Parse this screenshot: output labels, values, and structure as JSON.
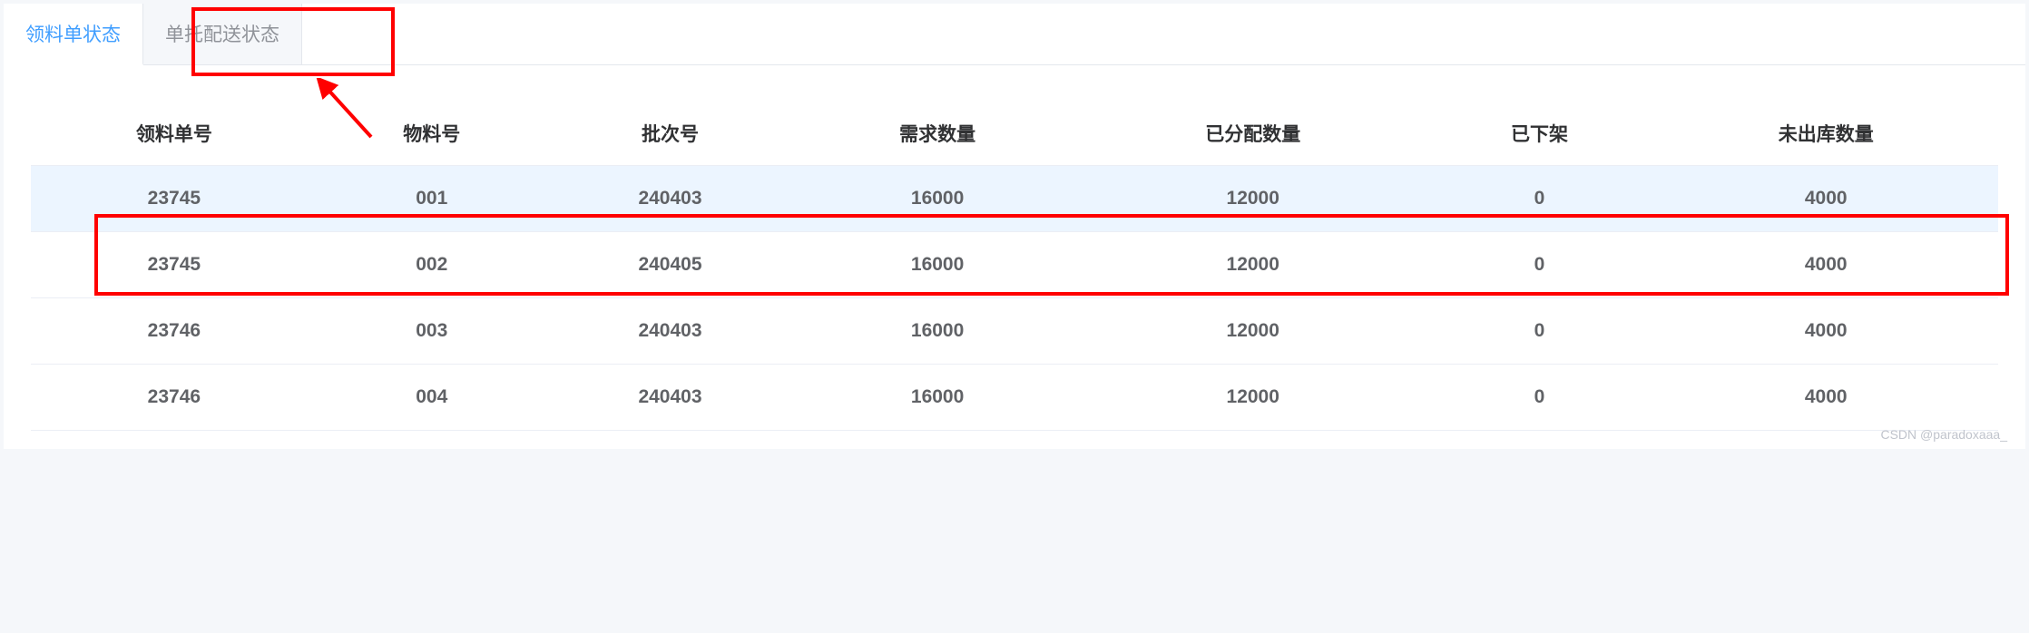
{
  "tabs": [
    {
      "label": "领料单状态",
      "active": true
    },
    {
      "label": "单托配送状态",
      "active": false
    }
  ],
  "table": {
    "headers": [
      "领料单号",
      "物料号",
      "批次号",
      "需求数量",
      "已分配数量",
      "已下架",
      "未出库数量"
    ],
    "rows": [
      {
        "cells": [
          "23745",
          "001",
          "240403",
          "16000",
          "12000",
          "0",
          "4000"
        ],
        "highlighted": true
      },
      {
        "cells": [
          "23745",
          "002",
          "240405",
          "16000",
          "12000",
          "0",
          "4000"
        ],
        "highlighted": false
      },
      {
        "cells": [
          "23746",
          "003",
          "240403",
          "16000",
          "12000",
          "0",
          "4000"
        ],
        "highlighted": false
      },
      {
        "cells": [
          "23746",
          "004",
          "240403",
          "16000",
          "12000",
          "0",
          "4000"
        ],
        "highlighted": false
      }
    ]
  },
  "watermark": "CSDN @paradoxaaa_"
}
